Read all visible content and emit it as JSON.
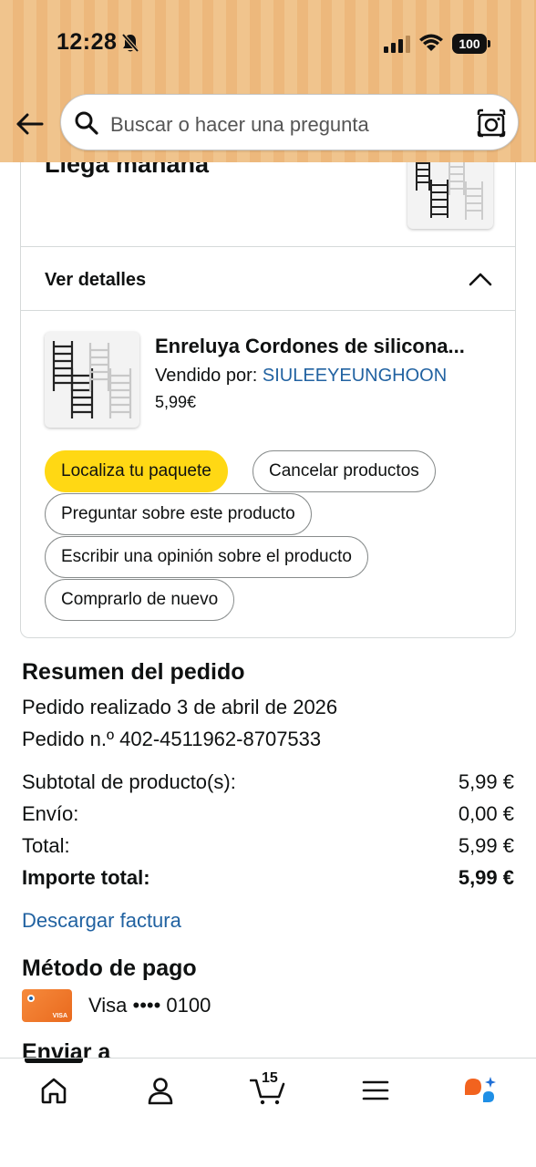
{
  "status_bar": {
    "time": "12:28",
    "battery": "100"
  },
  "search": {
    "placeholder": "Buscar o hacer una pregunta"
  },
  "delivery": {
    "arrival": "Llega mañana",
    "details_label": "Ver detalles"
  },
  "product": {
    "title": "Enreluya Cordones de silicona...",
    "sold_by_label": "Vendido por:",
    "seller": "SIULEEYEUNGHOON",
    "price": "5,99€"
  },
  "actions": {
    "track": "Localiza tu paquete",
    "cancel": "Cancelar productos",
    "ask": "Preguntar sobre este producto",
    "review": "Escribir una opinión sobre el producto",
    "buy_again": "Comprarlo de nuevo"
  },
  "summary": {
    "title": "Resumen del pedido",
    "placed": "Pedido realizado 3 de abril de 2026",
    "order_number": "Pedido n.º 402-4511962-8707533",
    "rows": [
      {
        "label": "Subtotal de producto(s):",
        "value": "5,99 €"
      },
      {
        "label": "Envío:",
        "value": "0,00 €"
      },
      {
        "label": "Total:",
        "value": "5,99 €"
      },
      {
        "label": "Importe total:",
        "value": "5,99 €"
      }
    ],
    "invoice_link": "Descargar factura"
  },
  "payment": {
    "title": "Método de pago",
    "card_text": "Visa •••• 0100",
    "card_badge": "VISA"
  },
  "shipping": {
    "title": "Enviar a"
  },
  "bottom_nav": {
    "cart_count": "15",
    "items": [
      "home-icon",
      "account-icon",
      "cart-icon",
      "menu-icon",
      "rufus-icon"
    ]
  },
  "colors": {
    "header_bg": "#f0c48d",
    "link": "#2162a1",
    "primary_button": "#ffd814",
    "card_orange": "#f68a3c"
  }
}
